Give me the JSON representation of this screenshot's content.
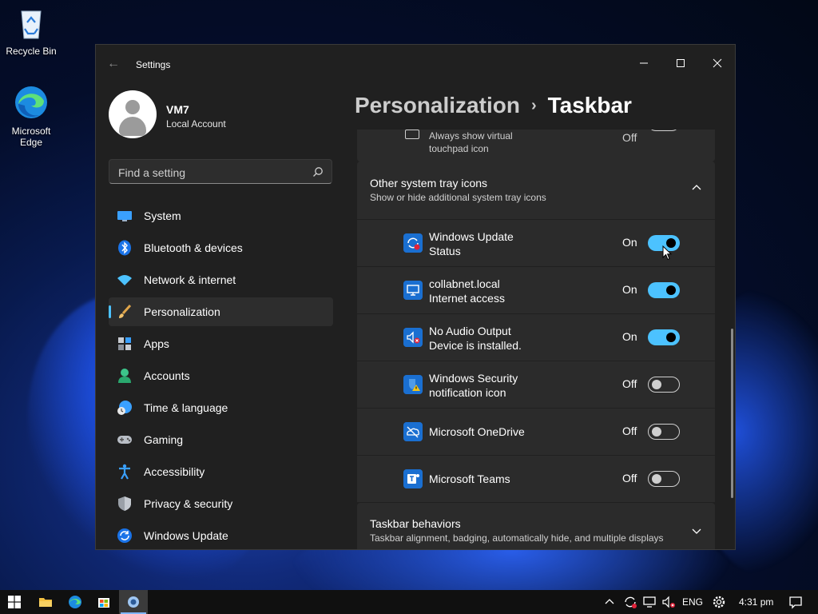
{
  "desktop": {
    "icons": [
      {
        "label": "Recycle Bin"
      },
      {
        "label": "Microsoft\nEdge"
      }
    ]
  },
  "window": {
    "title": "Settings",
    "controls": {
      "minimize": "—",
      "maximize": "☐",
      "close": "✕"
    }
  },
  "user": {
    "name": "VM7",
    "account_type": "Local Account"
  },
  "search": {
    "placeholder": "Find a setting"
  },
  "nav": {
    "items": [
      {
        "label": "System",
        "icon": "system-icon"
      },
      {
        "label": "Bluetooth & devices",
        "icon": "bluetooth-icon"
      },
      {
        "label": "Network & internet",
        "icon": "wifi-icon"
      },
      {
        "label": "Personalization",
        "icon": "brush-icon",
        "selected": true
      },
      {
        "label": "Apps",
        "icon": "apps-icon"
      },
      {
        "label": "Accounts",
        "icon": "accounts-icon"
      },
      {
        "label": "Time & language",
        "icon": "globe-clock-icon"
      },
      {
        "label": "Gaming",
        "icon": "gamepad-icon"
      },
      {
        "label": "Accessibility",
        "icon": "accessibility-icon"
      },
      {
        "label": "Privacy & security",
        "icon": "shield-icon"
      },
      {
        "label": "Windows Update",
        "icon": "update-icon"
      }
    ]
  },
  "breadcrumb": {
    "parent": "Personalization",
    "separator": "›",
    "current": "Taskbar"
  },
  "top_partial": {
    "label": "Always show virtual\ntouchpad icon",
    "state": "Off"
  },
  "tray_section": {
    "title": "Other system tray icons",
    "subtitle": "Show or hide additional system tray icons",
    "items": [
      {
        "label": "Windows Update\nStatus",
        "state": "On",
        "on": true,
        "icon": "windows-update-status-icon"
      },
      {
        "label": "collabnet.local\nInternet access",
        "state": "On",
        "on": true,
        "icon": "network-monitor-icon"
      },
      {
        "label": "No Audio Output\nDevice is installed.",
        "state": "On",
        "on": true,
        "icon": "speaker-muted-icon"
      },
      {
        "label": "Windows Security\nnotification icon",
        "state": "Off",
        "on": false,
        "icon": "security-warning-icon"
      },
      {
        "label": "Microsoft OneDrive",
        "state": "Off",
        "on": false,
        "icon": "onedrive-icon"
      },
      {
        "label": "Microsoft Teams",
        "state": "Off",
        "on": false,
        "icon": "teams-icon"
      }
    ]
  },
  "behaviors": {
    "title": "Taskbar behaviors",
    "subtitle": "Taskbar alignment, badging, automatically hide, and multiple displays"
  },
  "taskbar": {
    "language": "ENG",
    "time": "4:31 pm"
  },
  "colors": {
    "accent": "#4cc2ff",
    "window_bg": "#202020",
    "card_bg": "#2b2b2b"
  }
}
